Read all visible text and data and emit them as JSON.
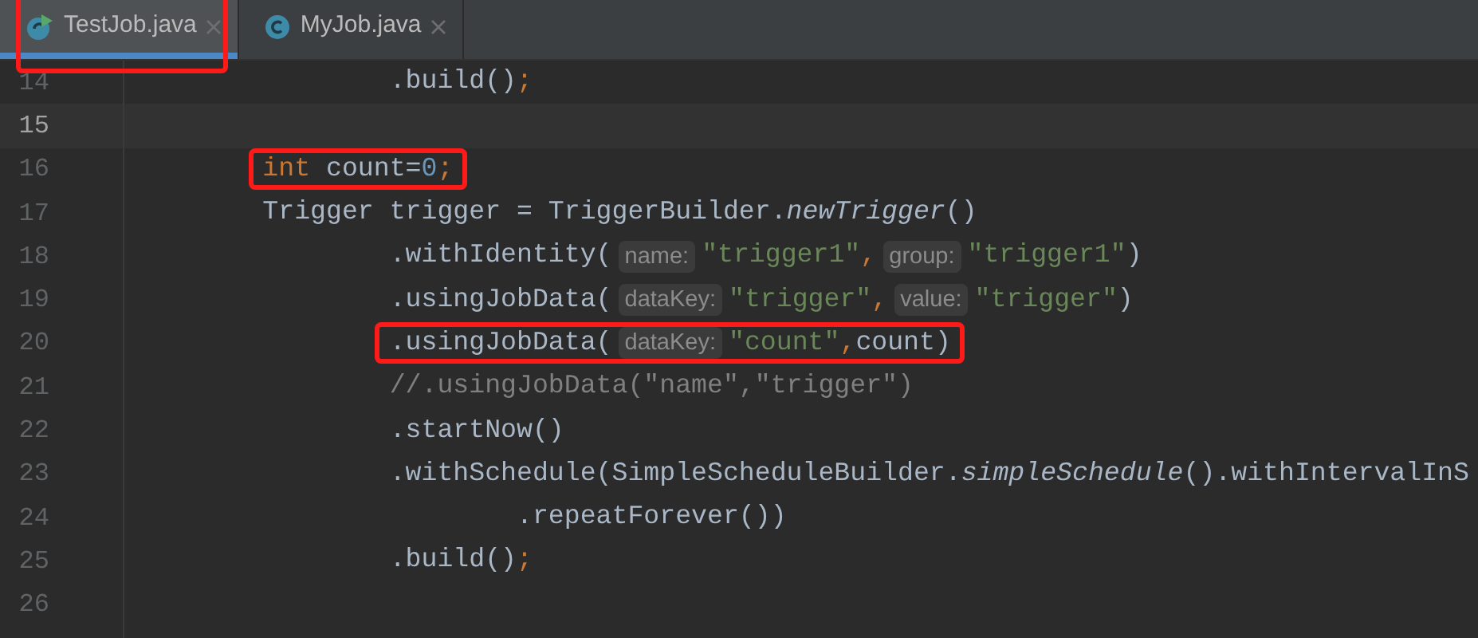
{
  "tabs": [
    {
      "label": "TestJob.java",
      "selected": true,
      "kind": "runnable",
      "highlighted": true
    },
    {
      "label": "MyJob.java",
      "selected": false,
      "kind": "class",
      "highlighted": false
    }
  ],
  "lines": [
    {
      "number": "14",
      "current": false,
      "highlighted": false,
      "tokens": [
        {
          "kind": "plain",
          "text": "                .build()"
        },
        {
          "kind": "punct",
          "text": ";"
        }
      ]
    },
    {
      "number": "15",
      "current": true,
      "highlighted": false
    },
    {
      "number": "16",
      "current": false,
      "highlighted": true,
      "tokens": [
        {
          "kind": "keyword",
          "text": "        int"
        },
        {
          "kind": "plain",
          "text": " count="
        },
        {
          "kind": "number",
          "text": "0"
        },
        {
          "kind": "punct",
          "text": ";"
        }
      ]
    },
    {
      "number": "17",
      "current": false,
      "highlighted": false,
      "tokens": [
        {
          "kind": "plain",
          "text": "        Trigger trigger = TriggerBuilder."
        },
        {
          "kind": "italic",
          "text": "newTrigger"
        },
        {
          "kind": "plain",
          "text": "()"
        }
      ]
    },
    {
      "number": "18",
      "current": false,
      "highlighted": false,
      "tokens": [
        {
          "kind": "plain",
          "text": "                .withIdentity("
        },
        {
          "kind": "hint",
          "text": "name:"
        },
        {
          "kind": "string",
          "text": "\"trigger1\""
        },
        {
          "kind": "punct",
          "text": ","
        },
        {
          "kind": "hint",
          "text": "group:"
        },
        {
          "kind": "string",
          "text": "\"trigger1\""
        },
        {
          "kind": "plain",
          "text": ")"
        }
      ]
    },
    {
      "number": "19",
      "current": false,
      "highlighted": false,
      "tokens": [
        {
          "kind": "plain",
          "text": "                .usingJobData("
        },
        {
          "kind": "hint",
          "text": "dataKey:"
        },
        {
          "kind": "string",
          "text": "\"trigger\""
        },
        {
          "kind": "punct",
          "text": ","
        },
        {
          "kind": "hint",
          "text": "value:"
        },
        {
          "kind": "string",
          "text": "\"trigger\""
        },
        {
          "kind": "plain",
          "text": ")"
        }
      ]
    },
    {
      "number": "20",
      "current": false,
      "highlighted": true,
      "tokens": [
        {
          "kind": "plain",
          "text": "                .usingJobData("
        },
        {
          "kind": "hint",
          "text": "dataKey:"
        },
        {
          "kind": "string",
          "text": "\"count\""
        },
        {
          "kind": "punct",
          "text": ","
        },
        {
          "kind": "plain",
          "text": "count)"
        }
      ]
    },
    {
      "number": "21",
      "current": false,
      "highlighted": false,
      "tokens": [
        {
          "kind": "comment",
          "text": "                //.usingJobData(\"name\",\"trigger\")"
        }
      ]
    },
    {
      "number": "22",
      "current": false,
      "highlighted": false,
      "tokens": [
        {
          "kind": "plain",
          "text": "                .startNow()"
        }
      ]
    },
    {
      "number": "23",
      "current": false,
      "highlighted": false,
      "tokens": [
        {
          "kind": "plain",
          "text": "                .withSchedule(SimpleScheduleBuilder."
        },
        {
          "kind": "italic",
          "text": "simpleSchedule"
        },
        {
          "kind": "plain",
          "text": "().withIntervalInS"
        }
      ]
    },
    {
      "number": "24",
      "current": false,
      "highlighted": false,
      "tokens": [
        {
          "kind": "plain",
          "text": "                        .repeatForever())"
        }
      ]
    },
    {
      "number": "25",
      "current": false,
      "highlighted": false,
      "tokens": [
        {
          "kind": "plain",
          "text": "                .build()"
        },
        {
          "kind": "punct",
          "text": ";"
        }
      ]
    },
    {
      "number": "26",
      "current": false,
      "highlighted": false
    }
  ]
}
